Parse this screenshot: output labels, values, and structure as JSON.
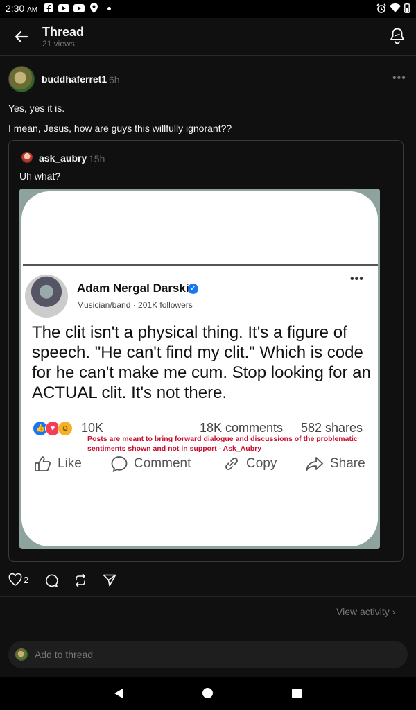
{
  "status_bar": {
    "time": "2:30",
    "ampm": "AM"
  },
  "header": {
    "title": "Thread",
    "views": "21 views"
  },
  "post": {
    "username": "buddhaferret1",
    "ago": "6h",
    "lines": [
      "Yes, yes it is.",
      "I mean, Jesus, how are guys this willfully ignorant??"
    ],
    "likes": "2"
  },
  "quoted": {
    "username": "ask_aubry",
    "ago": "15h",
    "text": "Uh what?",
    "image": {
      "name": "Adam Nergal Darski",
      "meta": "Musician/band · 201K followers",
      "body": "The clit isn't a physical thing. It's a figure of speech. \"He can't find my clit.\" Which is code for he can't make me cum.  Stop looking for an ACTUAL clit. It's not there.",
      "reactions": "10K",
      "comments": "18K comments",
      "shares": "582 shares",
      "note": "Posts are meant to bring forward dialogue and discussions of the problematic sentiments shown and not in support - Ask_Aubry",
      "actions": {
        "like": "Like",
        "comment": "Comment",
        "copy": "Copy",
        "share": "Share"
      }
    }
  },
  "activity_link": "View activity",
  "composer": {
    "placeholder": "Add to thread"
  },
  "colors": {
    "background": "#101010",
    "text": "#f3f5f7",
    "muted": "#777777",
    "fb_blue": "#1877f2",
    "note_red": "#c8102e"
  },
  "icons": [
    "back-arrow-icon",
    "notification-bell-icon",
    "heart-icon",
    "comment-icon",
    "repost-icon",
    "send-icon",
    "chevron-right-icon",
    "back-triangle-icon",
    "home-circle-icon",
    "recents-square-icon"
  ]
}
